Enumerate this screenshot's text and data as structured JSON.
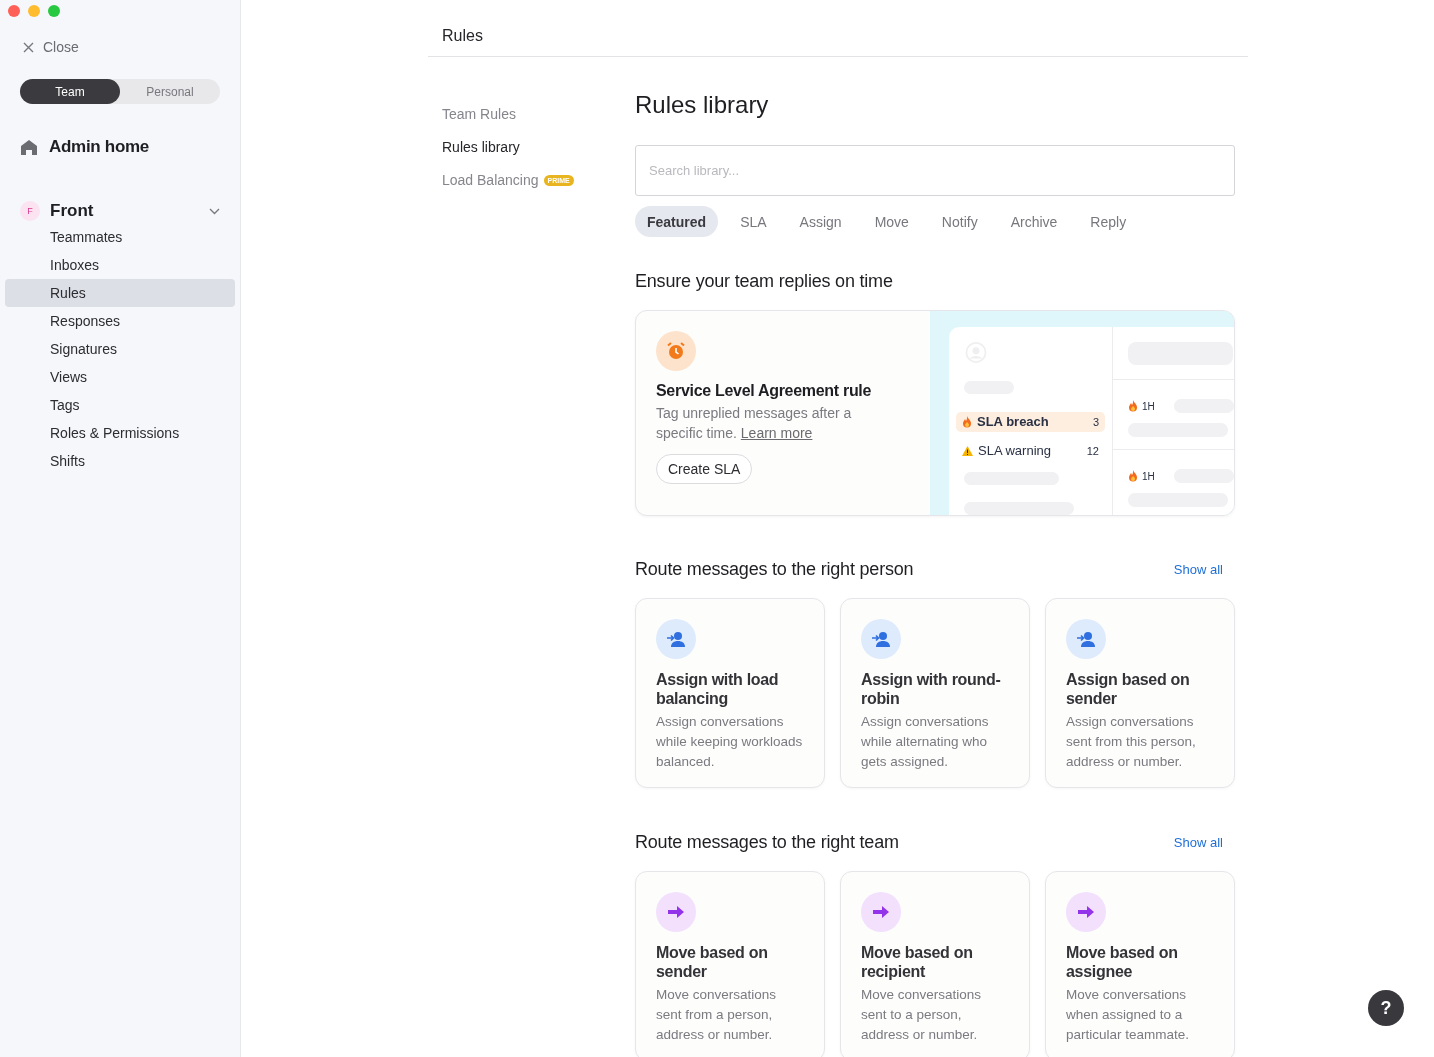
{
  "sidebar": {
    "close_label": "Close",
    "scope_toggle": [
      {
        "label": "Team",
        "selected": true
      },
      {
        "label": "Personal",
        "selected": false
      }
    ],
    "admin_home": "Admin home",
    "workspace": {
      "initial": "F",
      "name": "Front",
      "expanded": true,
      "items": [
        {
          "label": "Teammates",
          "selected": false
        },
        {
          "label": "Inboxes",
          "selected": false
        },
        {
          "label": "Rules",
          "selected": true
        },
        {
          "label": "Responses",
          "selected": false
        },
        {
          "label": "Signatures",
          "selected": false
        },
        {
          "label": "Views",
          "selected": false
        },
        {
          "label": "Tags",
          "selected": false
        },
        {
          "label": "Roles & Permissions",
          "selected": false
        },
        {
          "label": "Shifts",
          "selected": false
        }
      ]
    }
  },
  "main": {
    "title": "Rules",
    "subnav": [
      {
        "label": "Team Rules",
        "selected": false
      },
      {
        "label": "Rules library",
        "selected": true
      },
      {
        "label": "Load Balancing",
        "selected": false,
        "badge": "PRIME"
      }
    ],
    "library": {
      "heading": "Rules library",
      "search": {
        "placeholder": "Search library..."
      },
      "filters": [
        {
          "label": "Featured",
          "selected": true
        },
        {
          "label": "SLA",
          "selected": false
        },
        {
          "label": "Assign",
          "selected": false
        },
        {
          "label": "Move",
          "selected": false
        },
        {
          "label": "Notify",
          "selected": false
        },
        {
          "label": "Archive",
          "selected": false
        },
        {
          "label": "Reply",
          "selected": false
        }
      ],
      "featured": {
        "heading": "Ensure your team replies on time",
        "card": {
          "title": "Service Level Agreement rule",
          "description": "Tag unreplied messages after a specific time.",
          "link": "Learn more",
          "button": "Create SLA"
        },
        "preview": {
          "rows": [
            {
              "kind": "breach",
              "label": "SLA breach",
              "count": "3",
              "selected": true
            },
            {
              "kind": "warning",
              "label": "SLA warning",
              "count": "12",
              "selected": false
            }
          ],
          "timers": [
            "1H",
            "1H"
          ]
        }
      },
      "sections": [
        {
          "heading": "Route messages to the right person",
          "show_all": "Show all",
          "cards": [
            {
              "kind": "assign",
              "title": "Assign with load balancing",
              "description": "Assign conversations while keeping workloads balanced."
            },
            {
              "kind": "assign",
              "title": "Assign with round-robin",
              "description": "Assign conversations while alternating who gets assigned."
            },
            {
              "kind": "assign",
              "title": "Assign based on sender",
              "description": "Assign conversations sent from this person, address or number."
            }
          ]
        },
        {
          "heading": "Route messages to the right team",
          "show_all": "Show all",
          "cards": [
            {
              "kind": "move",
              "title": "Move based on sender",
              "description": "Move conversations sent from a person, address or number."
            },
            {
              "kind": "move",
              "title": "Move based on recipient",
              "description": "Move conversations sent to a person, address or number."
            },
            {
              "kind": "move",
              "title": "Move based on assignee",
              "description": "Move conversations when assigned to a particular teammate."
            }
          ]
        }
      ]
    }
  },
  "help": {
    "label": "?"
  }
}
